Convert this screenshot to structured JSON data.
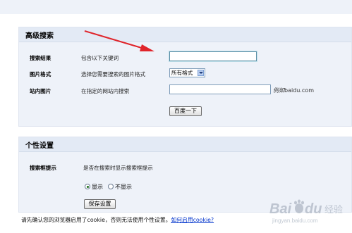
{
  "advanced_search": {
    "title": "高级搜索",
    "rows": [
      {
        "label": "搜索结果",
        "desc": "包含以下关键词",
        "value": ""
      },
      {
        "label": "图片格式",
        "desc": "选择您需要搜索的图片格式",
        "selected": "所有格式"
      },
      {
        "label": "站内图片",
        "desc": "在指定的网站内搜索",
        "value": "",
        "hint_prefix": "例如",
        "hint_domain": "baidu.com"
      }
    ],
    "search_button": "百度一下"
  },
  "personal_settings": {
    "title": "个性设置",
    "row_label": "搜索框提示",
    "row_desc": "是否在搜索时显示搜索框提示",
    "options": [
      {
        "label": "显示",
        "checked": true
      },
      {
        "label": "不显示",
        "checked": false
      }
    ],
    "save_button": "保存设置"
  },
  "footer": {
    "notice": "请先确认您的浏览器启用了cookie，否则无法使用个性设置。",
    "link": "如何启用cookie?"
  },
  "watermark": {
    "brand": "Bai du",
    "sub": "经验",
    "url": "jingyan.baidu.com"
  },
  "colors": {
    "arrow": "#e0242a",
    "panel_bg": "#eef2f9",
    "link": "#0033cc"
  }
}
